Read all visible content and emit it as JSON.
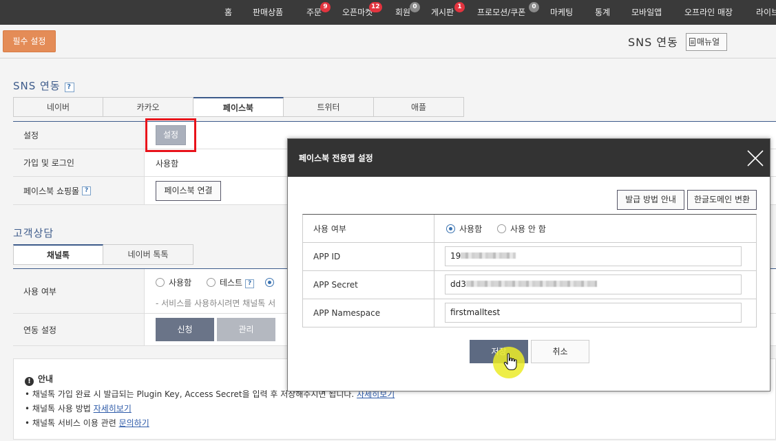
{
  "nav": {
    "items": [
      {
        "label": "홈"
      },
      {
        "label": "판매상품"
      },
      {
        "label": "주문",
        "badge": "9"
      },
      {
        "label": "오픈마켓",
        "badge": "12"
      },
      {
        "label": "회원",
        "badge": "0"
      },
      {
        "label": "게시판",
        "badge": "1"
      },
      {
        "label": "프로모션/쿠폰",
        "badge": "0"
      },
      {
        "label": "마케팅"
      },
      {
        "label": "통계"
      },
      {
        "label": "모바일앱"
      },
      {
        "label": "오프라인 매장"
      },
      {
        "label": "라이브"
      }
    ]
  },
  "header": {
    "required_button": "필수 설정",
    "page_title": "SNS 연동",
    "manual_button": "매뉴얼"
  },
  "sns": {
    "title": "SNS 연동",
    "help": "?",
    "tabs": [
      "네이버",
      "카카오",
      "페이스북",
      "트위터",
      "애플"
    ],
    "active_tab": "페이스북",
    "rows": {
      "setting_label": "설정",
      "setting_button": "설정",
      "join_label": "가입 및 로그인",
      "join_value": "사용함",
      "shop_label": "페이스북 쇼핑몰",
      "shop_button": "페이스북 연결"
    }
  },
  "cs": {
    "title": "고객상담",
    "tabs": [
      "채널톡",
      "네이버 톡톡"
    ],
    "active_tab": "채널톡",
    "rows": {
      "use_label": "사용 여부",
      "options": [
        "사용함",
        "테스트"
      ],
      "hint": "- 서비스를 사용하시려면 채널톡 서",
      "link_label": "연동 설정",
      "apply_button": "신청",
      "manage_button": "관리"
    }
  },
  "notice": {
    "title": "안내",
    "lines": [
      {
        "text": "채널톡 가입 완료 시 발급되는 Plugin Key, Access Secret을 입력 후 저장해주시면 됩니다.",
        "link": "자세히보기"
      },
      {
        "text": "채널톡 사용 방법",
        "link": "자세히보기"
      },
      {
        "text": "채널톡 서비스 이용 관련",
        "link": "문의하기"
      }
    ]
  },
  "modal": {
    "title": "페이스북 전용앱 설정",
    "guide_button": "발급 방법 안내",
    "domain_button": "한글도메인 변환",
    "use_label": "사용 여부",
    "use_on": "사용함",
    "use_off": "사용 안 함",
    "app_id_label": "APP ID",
    "app_id_prefix": "19",
    "app_secret_label": "APP Secret",
    "app_secret_prefix": "dd3",
    "namespace_label": "APP Namespace",
    "namespace_value": "firstmalltest",
    "save_button": "저장",
    "cancel_button": "취소"
  }
}
